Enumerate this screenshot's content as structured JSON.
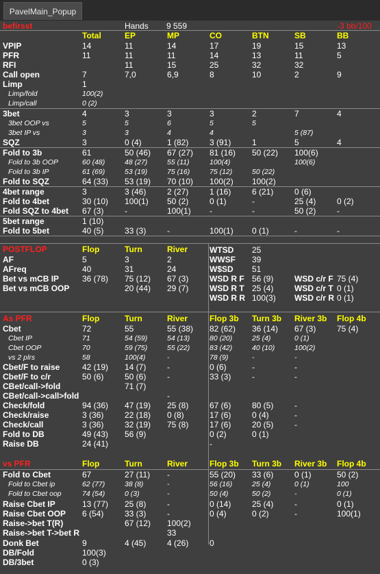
{
  "window": {
    "tab_title": "PavelMain_Popup"
  },
  "header": {
    "player": "befirsst",
    "hands_label": "Hands",
    "hands_value": "9 559",
    "winrate": "-3 bb/100"
  },
  "preflop": {
    "columns": [
      "Total",
      "EP",
      "MP",
      "CO",
      "BTN",
      "SB",
      "BB"
    ],
    "rows": [
      {
        "label": "VPIP",
        "values": [
          "14",
          "11",
          "14",
          "17",
          "19",
          "15",
          "13"
        ]
      },
      {
        "label": "PFR",
        "values": [
          "11",
          "11",
          "11",
          "14",
          "13",
          "11",
          "5"
        ]
      },
      {
        "label": "RFI",
        "values": [
          "",
          "11",
          "15",
          "25",
          "32",
          "32",
          ""
        ]
      },
      {
        "label": "Call open",
        "values": [
          "7",
          "7,0",
          "6,9",
          "8",
          "10",
          "2",
          "9"
        ]
      },
      {
        "label": "Limp",
        "values": [
          "1",
          "",
          "",
          "",
          "",
          "",
          ""
        ]
      },
      {
        "label": "Limp/fold",
        "values": [
          "100(2)",
          "",
          "",
          "",
          "",
          "",
          ""
        ]
      },
      {
        "label": "Limp/call",
        "values": [
          "0 (2)",
          "",
          "",
          "",
          "",
          "",
          ""
        ]
      },
      {
        "label": "3bet",
        "values": [
          "4",
          "3",
          "3",
          "3",
          "2",
          "7",
          "4"
        ]
      },
      {
        "label": "3bet OOP vs",
        "values": [
          "5",
          "5",
          "6",
          "5",
          "5",
          "",
          ""
        ]
      },
      {
        "label": "3bet IP vs",
        "values": [
          "3",
          "3",
          "4",
          "4",
          "",
          "5 (87)",
          ""
        ]
      },
      {
        "label": "SQZ",
        "values": [
          "3",
          "0 (4)",
          "1 (82)",
          "3 (91)",
          "1",
          "5",
          "4"
        ]
      },
      {
        "label": "Fold to 3b",
        "values": [
          "61",
          "50 (46)",
          "67 (27)",
          "81 (16)",
          "50 (22)",
          "100(6)",
          ""
        ]
      },
      {
        "label": "Fold to 3b OOP",
        "values": [
          "60 (48)",
          "48 (27)",
          "55 (11)",
          "100(4)",
          "",
          "100(6)",
          ""
        ]
      },
      {
        "label": "Fold to 3b IP",
        "values": [
          "61 (69)",
          "53 (19)",
          "75 (16)",
          "75 (12)",
          "50 (22)",
          "",
          ""
        ]
      },
      {
        "label": "Fold to SQZ",
        "values": [
          "64 (33)",
          "53 (19)",
          "70 (10)",
          "100(2)",
          "100(2)",
          "",
          ""
        ]
      },
      {
        "label": "4bet range",
        "values": [
          "3",
          "3 (46)",
          "2 (27)",
          "1 (16)",
          "6 (21)",
          "0 (6)",
          ""
        ]
      },
      {
        "label": "Fold to 4bet",
        "values": [
          "30 (10)",
          "100(1)",
          "50 (2)",
          "0 (1)",
          "-",
          "25 (4)",
          "0 (2)"
        ]
      },
      {
        "label": "Fold SQZ to 4bet",
        "values": [
          "67 (3)",
          "-",
          "100(1)",
          "-",
          "-",
          "50 (2)",
          "-"
        ]
      },
      {
        "label": "5bet range",
        "values": [
          "1 (10)",
          "",
          "",
          "",
          "",
          "",
          ""
        ]
      },
      {
        "label": "Fold to 5bet",
        "values": [
          "40 (5)",
          "33 (3)",
          "-",
          "100(1)",
          "0 (1)",
          "-",
          "-"
        ]
      }
    ]
  },
  "postflop": {
    "title": "POSTFLOP",
    "columns": [
      "Flop",
      "Turn",
      "River"
    ],
    "rows": [
      {
        "label": "AF",
        "values": [
          "5",
          "3",
          "2"
        ]
      },
      {
        "label": "AFreq",
        "values": [
          "40",
          "31",
          "24"
        ]
      },
      {
        "label": "Bet vs mCB IP",
        "values": [
          "36 (78)",
          "75 (12)",
          "67 (3)"
        ]
      },
      {
        "label": "Bet vs mCB OOP",
        "values": [
          "",
          "20 (44)",
          "29 (7)"
        ]
      }
    ],
    "showdown": [
      {
        "label": "WTSD",
        "value": "25"
      },
      {
        "label": "WWSF",
        "value": "39"
      },
      {
        "label": "W$SD",
        "value": "51"
      },
      {
        "label": "WSD R F",
        "value": "56 (9)"
      },
      {
        "label": "WSD R T",
        "value": "25 (4)"
      },
      {
        "label": "WSD R R",
        "value": "100(3)"
      }
    ],
    "showdown_cr": [
      {
        "label": "WSD c/r F",
        "value": "75 (4)"
      },
      {
        "label": "WSD c/r T",
        "value": "0 (1)"
      },
      {
        "label": "WSD c/r R",
        "value": "0 (1)"
      }
    ]
  },
  "as_pfr": {
    "title": "As PFR",
    "columns": [
      "Flop",
      "Turn",
      "River",
      "Flop 3b",
      "Turn 3b",
      "River 3b",
      "Flop 4b"
    ],
    "rows": [
      {
        "label": "Cbet",
        "values": [
          "72",
          "55",
          "55 (38)",
          "82 (62)",
          "36 (14)",
          "67 (3)",
          "75 (4)"
        ]
      },
      {
        "label": "Cbet IP",
        "values": [
          "71",
          "54 (59)",
          "54 (13)",
          "80 (20)",
          "25 (4)",
          "0 (1)",
          ""
        ]
      },
      {
        "label": "Cbet OOP",
        "values": [
          "70",
          "59 (75)",
          "55 (22)",
          "83 (42)",
          "40 (10)",
          "100(2)",
          ""
        ]
      },
      {
        "label": "vs 2 plrs",
        "values": [
          "58",
          "100(4)",
          "-",
          "78 (9)",
          "-",
          "-",
          ""
        ]
      },
      {
        "label": "Cbet/F to raise",
        "values": [
          "42 (19)",
          "14 (7)",
          "-",
          "0 (6)",
          "-",
          "-",
          ""
        ]
      },
      {
        "label": "Cbet/F to c/r",
        "values": [
          "50 (6)",
          "50 (6)",
          "-",
          "33 (3)",
          "-",
          "-",
          ""
        ]
      },
      {
        "label": "CBet/call->fold",
        "values": [
          "",
          "71 (7)",
          "",
          "",
          "",
          "",
          ""
        ]
      },
      {
        "label": "CBet/call->call>fold",
        "values": [
          "",
          "",
          "-",
          "",
          "",
          "",
          ""
        ]
      },
      {
        "label": "Check/fold",
        "values": [
          "94 (36)",
          "47 (19)",
          "25 (8)",
          "67 (6)",
          "80 (5)",
          "-",
          ""
        ]
      },
      {
        "label": "Check/raise",
        "values": [
          "3 (36)",
          "22 (18)",
          "0 (8)",
          "17 (6)",
          "0 (4)",
          "-",
          ""
        ]
      },
      {
        "label": "Check/call",
        "values": [
          "3 (36)",
          "32 (19)",
          "75 (8)",
          "17 (6)",
          "20 (5)",
          "-",
          ""
        ]
      },
      {
        "label": "Fold to DB",
        "values": [
          "49 (43)",
          "56 (9)",
          "",
          "0 (2)",
          "0 (1)",
          "",
          ""
        ]
      },
      {
        "label": "Raise DB",
        "values": [
          "24 (41)",
          "",
          "",
          "-",
          "",
          "",
          ""
        ]
      }
    ]
  },
  "vs_pfr": {
    "title": "vs PFR",
    "columns": [
      "Flop",
      "Turn",
      "River",
      "Flop 3b",
      "Turn 3b",
      "River 3b",
      "Flop 4b"
    ],
    "rows": [
      {
        "label": "Fold to Cbet",
        "values": [
          "67",
          "27 (11)",
          "-",
          "55 (20)",
          "33 (6)",
          "0 (1)",
          "50 (2)"
        ]
      },
      {
        "label": "Fold to Cbet ip",
        "values": [
          "62 (77)",
          "38 (8)",
          "-",
          "56 (16)",
          "25 (4)",
          "0 (1)",
          "100"
        ]
      },
      {
        "label": "Fold to Cbet oop",
        "values": [
          "74 (54)",
          "0 (3)",
          "-",
          "50 (4)",
          "50 (2)",
          "-",
          "0 (1)"
        ]
      },
      {
        "label": "Raise Cbet IP",
        "values": [
          "13 (77)",
          "25 (8)",
          "-",
          "0 (14)",
          "25 (4)",
          "-",
          "0 (1)"
        ]
      },
      {
        "label": "Raise Cbet OOP",
        "values": [
          "6 (54)",
          "33 (3)",
          "-",
          "0 (4)",
          "0 (2)",
          "-",
          "100(1)"
        ]
      },
      {
        "label": "Raise->bet T(R)",
        "values": [
          "",
          "67 (12)",
          "100(2)",
          "",
          "",
          "",
          ""
        ]
      },
      {
        "label": "Raise->bet T->bet R",
        "values": [
          "",
          "",
          "33",
          "",
          "",
          "",
          ""
        ]
      },
      {
        "label": "Donk Bet",
        "values": [
          "9",
          "4 (45)",
          "4 (26)",
          "0",
          "",
          "",
          ""
        ]
      },
      {
        "label": "DB/Fold",
        "values": [
          "100(3)",
          "",
          "",
          "",
          "",
          "",
          ""
        ]
      },
      {
        "label": "DB/3bet",
        "values": [
          "0 (3)",
          "",
          "",
          "",
          "",
          "",
          ""
        ]
      }
    ]
  },
  "colors": {
    "background": "#3f3f3f",
    "header_text": "#ffff00",
    "accent_red": "#ff2020",
    "text": "#ffffff",
    "separator": "#8a8a8a"
  }
}
